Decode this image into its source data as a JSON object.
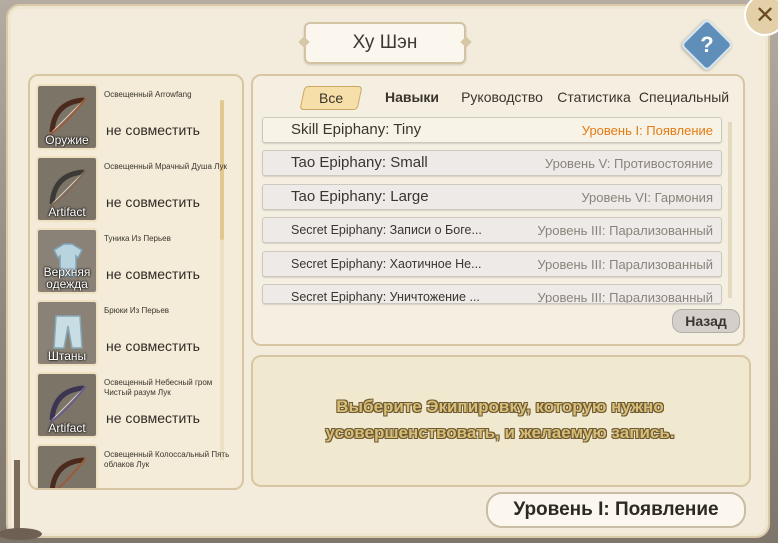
{
  "window": {
    "title": "Ху Шэн",
    "help_glyph": "?",
    "close_glyph": "✕"
  },
  "equipment": [
    {
      "name": "Освещенный Arrowfang",
      "tag": "Оружие",
      "status": "не совместить",
      "icon": "bow-icon"
    },
    {
      "name": "Освещенный Мрачный Душа Лук",
      "tag": "Artifact",
      "status": "не совместить",
      "icon": "bow-icon"
    },
    {
      "name": "Туника Из Перьев",
      "tag": "Верхняя одежда",
      "status": "не совместить",
      "icon": "tunic-icon"
    },
    {
      "name": "Брюки Из Перьев",
      "tag": "Штаны",
      "status": "не совместить",
      "icon": "pants-icon"
    },
    {
      "name": "Освещенный Небесный гром Чистый разум Лук",
      "tag": "Artifact",
      "status": "не совместить",
      "icon": "bow-icon"
    },
    {
      "name": "Освещенный Колоссальный Пять облаков Лук",
      "tag": "",
      "status": "",
      "icon": "bow-icon"
    }
  ],
  "tabs": [
    {
      "label": "Все",
      "active": true
    },
    {
      "label": "Навыки",
      "active": false
    },
    {
      "label": "Руководство",
      "active": false
    },
    {
      "label": "Статистика",
      "active": false
    },
    {
      "label": "Специальный",
      "active": false
    }
  ],
  "epiphanies": [
    {
      "name": "Skill Epiphany: Tiny",
      "level": "Уровень I: Появление",
      "selected": true
    },
    {
      "name": "Tao Epiphany: Small",
      "level": "Уровень V: Противостояние",
      "selected": false
    },
    {
      "name": "Tao Epiphany: Large",
      "level": "Уровень VI: Гармония",
      "selected": false
    },
    {
      "name": "Secret Epiphany: Записи о Боге...",
      "level": "Уровень III: Парализованный",
      "selected": false
    },
    {
      "name": "Secret Epiphany:  Хаотичное Не...",
      "level": "Уровень III: Парализованный",
      "selected": false
    },
    {
      "name": "Secret Epiphany:  Уничтожение ...",
      "level": "Уровень III: Парализованный",
      "selected": false
    }
  ],
  "back_label": "Назад",
  "hint_line1": "Выберите Экипировку, которую нужно",
  "hint_line2": "усовершенствовать, и желаемую запись.",
  "current_level": "Уровень I: Появление",
  "colors": {
    "accent_orange": "#e47a13",
    "hint_gold": "#d8be76",
    "help_blue": "#5f8fb8"
  }
}
